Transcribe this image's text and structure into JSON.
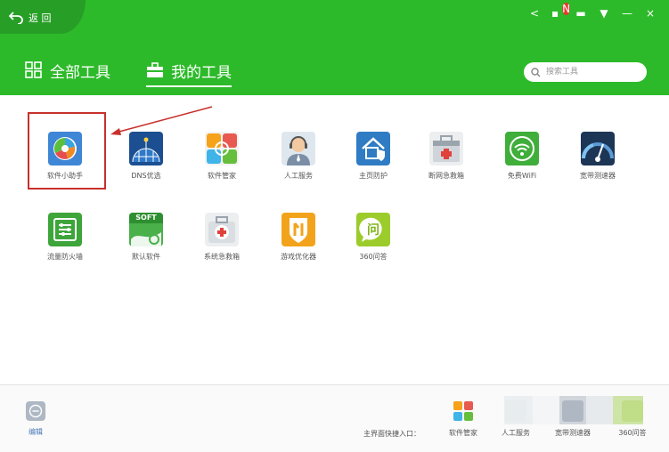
{
  "header": {
    "back_label": "返 回",
    "tab_all": "全部工具",
    "tab_mine": "我的工具",
    "search_placeholder": "搜索工具"
  },
  "window_controls": {
    "share": "<",
    "skin": "▪",
    "message": "▬",
    "menu": "▼",
    "minimize": "—",
    "close": "×",
    "badge": "N"
  },
  "tools": [
    {
      "label": "软件小助手",
      "icon": "software-assistant-icon"
    },
    {
      "label": "DNS优选",
      "icon": "dns-globe-icon"
    },
    {
      "label": "软件管家",
      "icon": "software-manager-icon"
    },
    {
      "label": "人工服务",
      "icon": "customer-service-icon"
    },
    {
      "label": "主页防护",
      "icon": "homepage-shield-icon"
    },
    {
      "label": "断网急救箱",
      "icon": "network-firstaid-icon"
    },
    {
      "label": "免费WiFi",
      "icon": "wifi-icon"
    },
    {
      "label": "宽带测速器",
      "icon": "speedometer-icon"
    },
    {
      "label": "流量防火墙",
      "icon": "traffic-firewall-icon"
    },
    {
      "label": "默认软件",
      "icon": "default-software-icon",
      "badge": "SOFT"
    },
    {
      "label": "系统急救箱",
      "icon": "system-firstaid-icon"
    },
    {
      "label": "游戏优化器",
      "icon": "game-optimizer-icon"
    },
    {
      "label": "360问答",
      "icon": "qa-icon",
      "glyph": "问"
    }
  ],
  "footer": {
    "edit_label": "编辑",
    "shortcut_label": "主界面快捷入口：",
    "shortcuts": [
      {
        "label": "软件管家",
        "icon": "software-manager-icon"
      },
      {
        "label": "人工服务",
        "icon": "customer-service-icon"
      },
      {
        "label": "宽带测速器",
        "icon": "speedometer-icon"
      },
      {
        "label": "360问答",
        "icon": "qa-icon"
      }
    ]
  },
  "colors": {
    "header": "#2dba2a",
    "back_tab": "#279e26",
    "highlight": "#c8302c"
  }
}
